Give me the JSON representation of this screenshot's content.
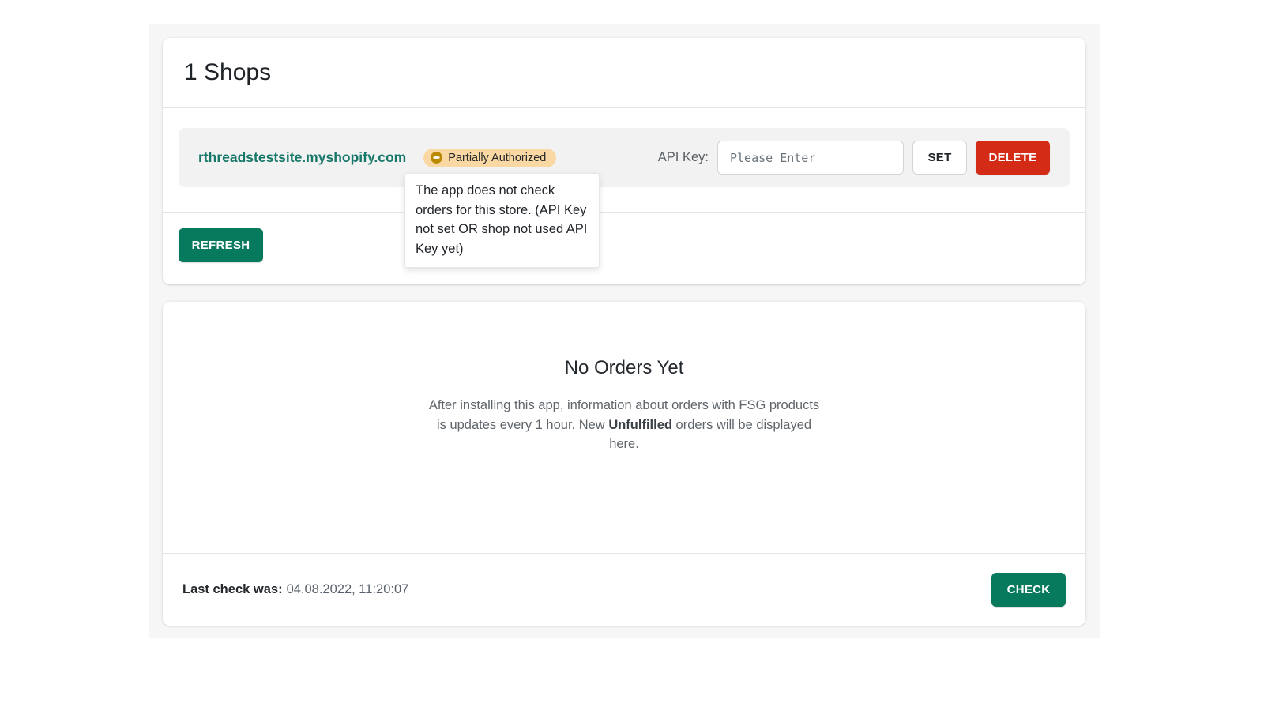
{
  "colors": {
    "accent_green": "#077a5e",
    "danger_red": "#d32b16",
    "shop_link_teal": "#17786a",
    "badge_bg": "#fad8a3",
    "badge_icon": "#b98900",
    "container_bg": "#f6f6f7"
  },
  "shops_card": {
    "title": "1 Shops",
    "shop": {
      "domain": "rthreadstestsite.myshopify.com",
      "badge_label": "Partially Authorized",
      "badge_icon": "partially-complete-circle-icon",
      "tooltip_lines": [
        "The app does not check",
        "orders for this store. (API Key",
        "not set OR shop not used API",
        "Key yet)"
      ],
      "api_key_label": "API Key:",
      "api_key_value": "",
      "api_key_placeholder": "Please Enter",
      "set_label": "SET",
      "delete_label": "DELETE"
    },
    "refresh_label": "REFRESH"
  },
  "orders_card": {
    "empty_title": "No Orders Yet",
    "empty_text_prefix": "After installing this app, information about orders with FSG products is updates every 1 hour. New ",
    "empty_text_bold": "Unfulfilled",
    "empty_text_suffix": " orders will be displayed here.",
    "last_check_label": "Last check was:",
    "last_check_value": "04.08.2022, 11:20:07",
    "check_label": "CHECK"
  }
}
